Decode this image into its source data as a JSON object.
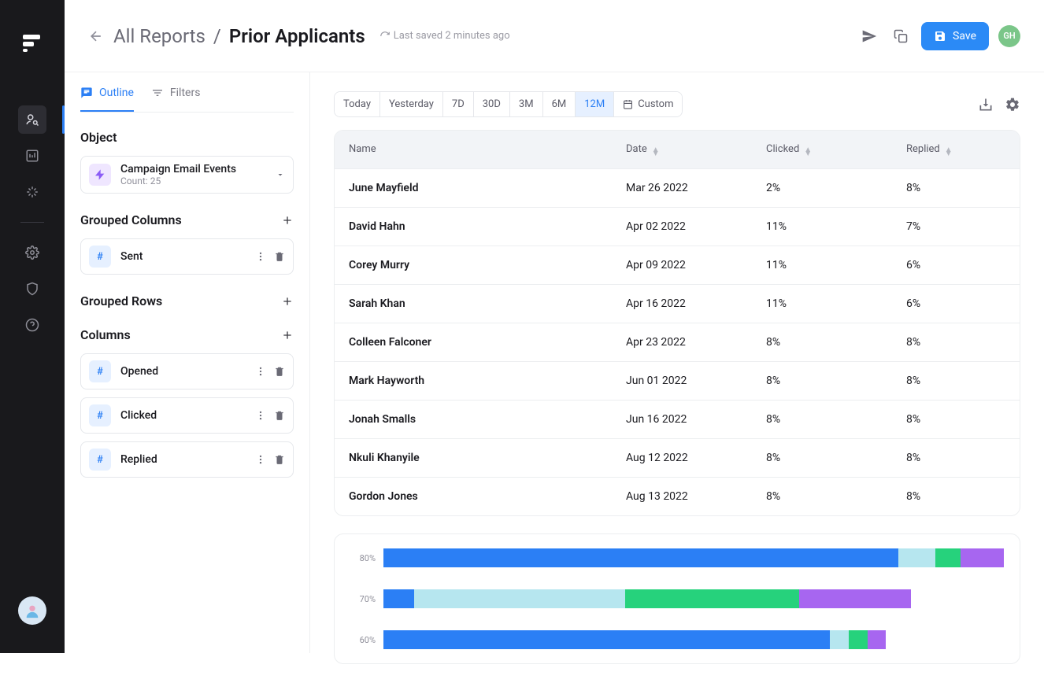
{
  "header": {
    "breadcrumb_root": "All Reports",
    "title": "Prior Applicants",
    "last_saved": "Last saved 2 minutes ago",
    "save_label": "Save",
    "user_initials": "GH"
  },
  "left_panel": {
    "tabs": {
      "outline": "Outline",
      "filters": "Filters"
    },
    "object": {
      "heading": "Object",
      "name": "Campaign Email Events",
      "subtext": "Count: 25"
    },
    "grouped_columns": {
      "heading": "Grouped Columns",
      "items": [
        "Sent"
      ]
    },
    "grouped_rows": {
      "heading": "Grouped Rows"
    },
    "columns": {
      "heading": "Columns",
      "items": [
        "Opened",
        "Clicked",
        "Replied"
      ]
    }
  },
  "toolbar": {
    "ranges": [
      "Today",
      "Yesterday",
      "7D",
      "30D",
      "3M",
      "6M",
      "12M",
      "Custom"
    ],
    "active_index": 6
  },
  "table": {
    "headers": {
      "name": "Name",
      "date": "Date",
      "clicked": "Clicked",
      "replied": "Replied"
    },
    "rows": [
      {
        "name": "June Mayfield",
        "date": "Mar 26 2022",
        "clicked": "2%",
        "replied": "8%"
      },
      {
        "name": "David Hahn",
        "date": "Apr 02 2022",
        "clicked": "11%",
        "replied": "7%"
      },
      {
        "name": "Corey Murry",
        "date": "Apr 09 2022",
        "clicked": "11%",
        "replied": "6%"
      },
      {
        "name": "Sarah Khan",
        "date": "Apr 16 2022",
        "clicked": "11%",
        "replied": "6%"
      },
      {
        "name": "Colleen Falconer",
        "date": "Apr 23 2022",
        "clicked": "8%",
        "replied": "8%"
      },
      {
        "name": "Mark Hayworth",
        "date": "Jun 01 2022",
        "clicked": "8%",
        "replied": "8%"
      },
      {
        "name": "Jonah Smalls",
        "date": "Jun 16 2022",
        "clicked": "8%",
        "replied": "8%"
      },
      {
        "name": "Nkuli Khanyile",
        "date": "Aug 12 2022",
        "clicked": "8%",
        "replied": "8%"
      },
      {
        "name": "Gordon Jones",
        "date": "Aug 13 2022",
        "clicked": "8%",
        "replied": "8%"
      }
    ]
  },
  "chart_data": {
    "type": "bar",
    "orientation": "horizontal-stacked",
    "categories": [
      "80%",
      "70%",
      "60%"
    ],
    "series_colors": {
      "blue": "#2b7ff5",
      "light": "#b6e6ef",
      "green": "#26d27c",
      "purple": "#a766f0"
    },
    "series": [
      {
        "name": "80%",
        "total": 100,
        "segments": [
          {
            "color": "blue",
            "value": 83
          },
          {
            "color": "light",
            "value": 6
          },
          {
            "color": "green",
            "value": 4
          },
          {
            "color": "purple",
            "value": 7
          }
        ]
      },
      {
        "name": "70%",
        "total": 85,
        "segments": [
          {
            "color": "blue",
            "value": 5
          },
          {
            "color": "light",
            "value": 34
          },
          {
            "color": "green",
            "value": 28
          },
          {
            "color": "purple",
            "value": 18
          }
        ]
      },
      {
        "name": "60%",
        "total": 81,
        "segments": [
          {
            "color": "blue",
            "value": 72
          },
          {
            "color": "light",
            "value": 3
          },
          {
            "color": "green",
            "value": 3
          },
          {
            "color": "purple",
            "value": 3
          }
        ]
      }
    ],
    "xlim": [
      0,
      100
    ]
  }
}
